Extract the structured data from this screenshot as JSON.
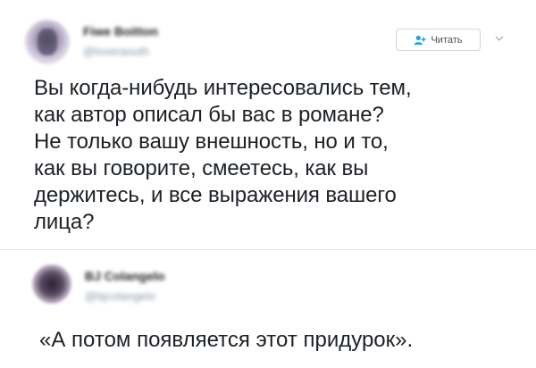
{
  "tweet": {
    "author_name": "Fiwe Boitton",
    "author_handle": "@loveraouth",
    "follow_label": "Читать",
    "text": "Вы когда-нибудь интересовались тем,\nкак автор описал бы вас в романе?\nНе только вашу внешность, но и то,\nкак вы говорите, смеетесь, как вы\nдержитесь, и все выражения вашего\nлица?",
    "accent_color": "#1da1f2"
  },
  "reply": {
    "author_name": "BJ Colangelo",
    "author_handle": "@bjcolangelo",
    "text": "«А потом появляется этот придурок»."
  },
  "icons": {
    "follow": "add-user-icon",
    "menu": "chevron-down-icon"
  }
}
